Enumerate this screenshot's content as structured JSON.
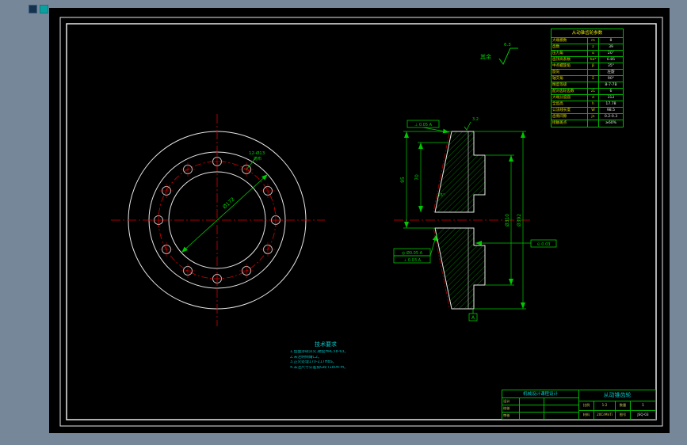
{
  "param_table": {
    "title": "从动锥齿轮参数",
    "rows": [
      [
        "大端模数",
        "m",
        "8"
      ],
      [
        "齿数",
        "z",
        "39"
      ],
      [
        "压力角",
        "α",
        "20°"
      ],
      [
        "齿顶高系数",
        "ha*",
        "0.85"
      ],
      [
        "中点螺旋角",
        "β",
        "35°"
      ],
      [
        "旋向",
        "",
        "左旋"
      ],
      [
        "轴交角",
        "Σ",
        "90°"
      ],
      [
        "精度等级",
        "",
        "8-7-7B"
      ],
      [
        "配对齿轮齿数",
        "z1",
        "6"
      ],
      [
        "大端分度圆",
        "d",
        "312"
      ],
      [
        "全齿高",
        "h",
        "17.78"
      ],
      [
        "公法线长度",
        "W",
        "98.5"
      ],
      [
        "齿侧间隙",
        "jn",
        "0.2-0.3"
      ],
      [
        "接触斑点",
        "",
        "≥60%"
      ]
    ]
  },
  "tech": {
    "title": "技术要求",
    "lines": [
      "1.齿面渗碳淬火,硬度HRC58-63。",
      "2.未注明倒角C2。",
      "3.正火处理170-217HBS。",
      "4.未注尺寸公差按GB/T1804-m。"
    ]
  },
  "dims": {
    "dia_main": "Ø172",
    "holes": "12-Ø13",
    "holes2": "均布",
    "d_outer": "Ø392",
    "d_inner": "Ø310",
    "w1": "95",
    "w2": "70",
    "angle": "35°",
    "gdt1": "⊥ 0.05 A",
    "gdt2a": "◎ Ø0.05 A",
    "gdt2b": "⊥ 0.03 A",
    "gdt3": "⊙ 0.03",
    "datum": "A",
    "rough_note": "其余",
    "rough_val": "6.3",
    "rough_top": "3.2"
  },
  "title_block": {
    "company": "机械设计课程设计",
    "part_name": "从动锥齿轮",
    "sign_labels": [
      "设计",
      "校核",
      "审核"
    ],
    "scale_label": "比例",
    "scale": "1:2",
    "qty_label": "数量",
    "qty": "1",
    "material_label": "材料",
    "material": "20CrMnTi",
    "no_label": "图号",
    "drawing_no": "JSQ-03"
  }
}
